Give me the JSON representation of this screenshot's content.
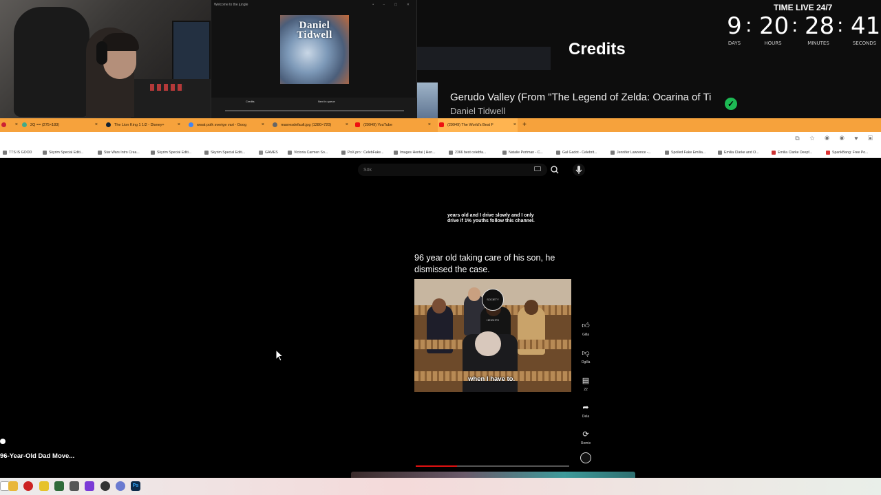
{
  "overlay": {
    "mini_window_title": "Welcome to the jungle",
    "album_logo": "Daniel Tidwell",
    "mini_tab_1": "Credits",
    "mini_tab_2": "Next in queue",
    "credits_heading": "Credits",
    "track_title": "Gerudo Valley (From \"The Legend of Zelda: Ocarina of Tir",
    "track_artist": "Daniel Tidwell",
    "timer": {
      "label": "TIME LIVE 24/7",
      "days": "9",
      "hours": "20",
      "minutes": "28",
      "seconds": "41",
      "days_label": "DAYS",
      "hours_label": "HOURS",
      "minutes_label": "MINUTES",
      "seconds_label": "SECONDS"
    }
  },
  "browser": {
    "tabs": [
      {
        "label": ""
      },
      {
        "label": "2Q == (275×183)"
      },
      {
        "label": "The Lion King 1 1/2 - Disney+"
      },
      {
        "label": "wwat polk sverige vari - Goog"
      },
      {
        "label": "maxresdefault.jpg (1280×720)"
      },
      {
        "label": "(29949) YouTube"
      },
      {
        "label": "(29949) The World's Best F"
      }
    ],
    "bookmarks": [
      "TTS IS GOOD",
      "Skyrim Special Editi...",
      "Star Wars Intro Crea...",
      "Skyrim Special Editi...",
      "Skyrim Special Editi...",
      "GAMES",
      "Victoria Carmen So...",
      "PoX.pro : CelebFake...",
      "Images Hentai | Hen...",
      "2366 best celebfa...",
      "Natalie Portman - C...",
      "Gal Gadot - Celebrit...",
      "Jennifer Lawrence -...",
      "Spoiled Fake Emilia...",
      "Emilia Clarke and O...",
      "Emilia Clarke Deepf...",
      "SpankBang: Free Po..."
    ]
  },
  "page": {
    "search_placeholder": "Sök",
    "short": {
      "top_text": "years old and I drive slowly and I only drive if 1% youths follow this channel.",
      "caption": "96 year old taking care of his son, he dismissed the case.",
      "subtitle": "when I have to.",
      "channel_badge": "SOCIETY HEIGHTS",
      "progress": 0.27
    },
    "actions": {
      "like": "Gilla",
      "dislike": "Ogilla",
      "comments": "22",
      "share": "Dela",
      "remix": "Remix"
    },
    "mini_player_label": "96-Year-Old Dad Move..."
  },
  "colors": {
    "tab_strip": "#f6a23c",
    "progress": "#e11111",
    "check": "#1db954"
  }
}
